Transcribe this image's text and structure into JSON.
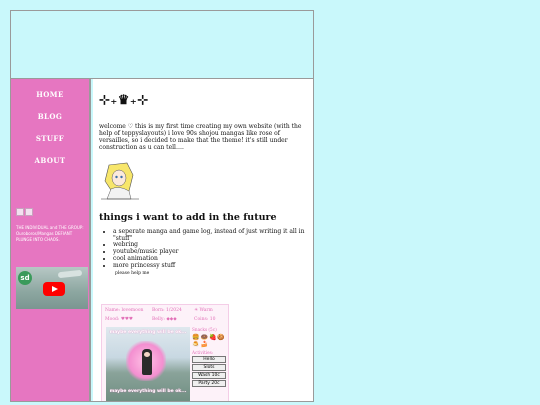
{
  "nav": {
    "items": [
      {
        "label": "HOME"
      },
      {
        "label": "BLOG"
      },
      {
        "label": "STUFF"
      },
      {
        "label": "ABOUT"
      }
    ]
  },
  "sidebar": {
    "blurb": "THE INDIVIDUAL and THE GROUP: Ouroboros/Mangas DEFIANT PLUNGE INTO CHAOS."
  },
  "video": {
    "channel_avatar": "sd"
  },
  "main": {
    "sparkle_title": "⊹₊♛₊⊹",
    "intro": "welcome ♡ this is my first time creating my own website (with the help of teppyslayouts) i love 90s shojou mangas like rose of versailles, so i decided to make that the theme! it's still under construction as u can tell….",
    "future_title": "things i want to add in the future",
    "future_items": [
      "a seperate manga and game log, instead of just writing it all in \"stuff\"",
      "webring",
      "youtube/music player",
      "cool animation",
      "more princessy stuff"
    ],
    "help_text": "please help me"
  },
  "pet": {
    "name": "Name: lovemoon",
    "born": "Born: 1/2024",
    "weather": "☀ Warm",
    "mood": "Mood: ♥♥♥",
    "belly": "Belly: ◆◆◆",
    "coins": "Coins: 10",
    "caption_top": "maybe everything will be ok...",
    "caption_bottom": "maybe everything will be ok...",
    "snacks_label": "Snacks (5c)",
    "snacks_icons": "🍔🍩🍓🍪🍮🍰",
    "activities_label": "Activities:",
    "buttons": [
      {
        "label": "Hello"
      },
      {
        "label": "Slots"
      },
      {
        "label": "Wash 10c"
      },
      {
        "label": "Party 20c"
      }
    ]
  }
}
